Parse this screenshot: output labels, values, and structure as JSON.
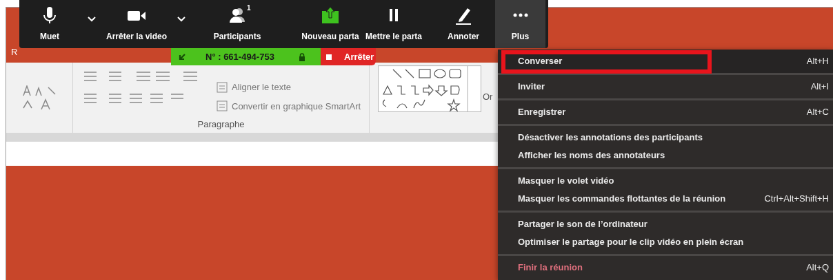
{
  "app_window": {
    "title_fragment": "R"
  },
  "toolbar": {
    "buttons": [
      {
        "label": "Muet",
        "kind": "mic",
        "caret": true,
        "selected": false
      },
      {
        "label": "Arrêter la video",
        "kind": "camera",
        "caret": true,
        "selected": false
      },
      {
        "label": "Participants",
        "kind": "people",
        "badge": "1",
        "caret": false,
        "selected": false
      },
      {
        "label": "Nouveau parta",
        "kind": "share",
        "caret": false,
        "selected": false
      },
      {
        "label": "Mettre le parta",
        "kind": "pause",
        "caret": false,
        "selected": false
      },
      {
        "label": "Annoter",
        "kind": "pencil",
        "caret": false,
        "selected": false
      },
      {
        "label": "Plus",
        "kind": "dots",
        "caret": false,
        "selected": true
      }
    ]
  },
  "share_bar": {
    "meeting_id": "N° : 661-494-753",
    "stop": "Arrêter"
  },
  "ribbon": {
    "commands": [
      "Aligner le texte",
      "Convertir en graphique SmartArt"
    ],
    "group_label": "Paragraphe",
    "next_group_fragment": "Or"
  },
  "menu": {
    "groups": [
      {
        "items": [
          {
            "label": "Converser",
            "shortcut": "Alt+H",
            "kind": "normal",
            "highlighted": true
          }
        ]
      },
      {
        "items": [
          {
            "label": "Inviter",
            "shortcut": "Alt+I",
            "kind": "normal",
            "highlighted": false
          }
        ]
      },
      {
        "items": [
          {
            "label": "Enregistrer",
            "shortcut": "Alt+C",
            "kind": "normal",
            "highlighted": false
          }
        ]
      },
      {
        "items": [
          {
            "label": "Désactiver les annotations des participants",
            "kind": "normal",
            "highlighted": false
          },
          {
            "label": "Afficher les noms des annotateurs",
            "kind": "normal",
            "highlighted": false
          }
        ]
      },
      {
        "items": [
          {
            "label": "Masquer le volet vidéo",
            "kind": "normal",
            "highlighted": false
          },
          {
            "label": "Masquer les commandes flottantes de la réunion",
            "shortcut": "Ctrl+Alt+Shift+H",
            "kind": "normal",
            "highlighted": false
          }
        ]
      },
      {
        "items": [
          {
            "label": "Partager le son de l’ordinateur",
            "kind": "normal",
            "highlighted": false
          },
          {
            "label": "Optimiser le partage pour le clip vidéo en plein écran",
            "kind": "normal",
            "highlighted": false
          }
        ]
      },
      {
        "items": [
          {
            "label": "Finir la réunion",
            "shortcut": "Alt+Q",
            "kind": "danger",
            "highlighted": false
          }
        ]
      }
    ]
  }
}
